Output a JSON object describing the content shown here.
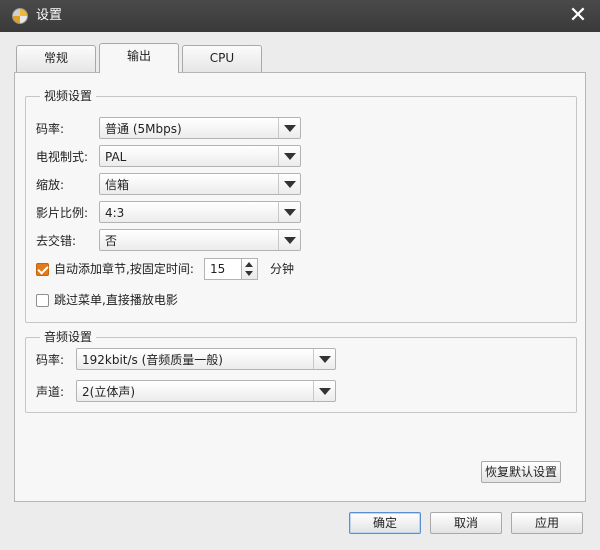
{
  "window": {
    "title": "设置",
    "close_glyph": "✕"
  },
  "tabs": [
    {
      "label": "常规"
    },
    {
      "label": "输出"
    },
    {
      "label": "CPU"
    }
  ],
  "video": {
    "legend": "视频设置",
    "bitrate": {
      "label": "码率:",
      "value": "普通 (5Mbps)"
    },
    "tv_standard": {
      "label": "电视制式:",
      "value": "PAL"
    },
    "zoom": {
      "label": "缩放:",
      "value": "信箱"
    },
    "aspect": {
      "label": "影片比例:",
      "value": "4:3"
    },
    "deinterlace": {
      "label": "去交错:",
      "value": "否"
    },
    "auto_chapter": {
      "label": "自动添加章节,按固定时间:",
      "checked": true,
      "value": "15",
      "unit": "分钟"
    },
    "skip_menu": {
      "label": "跳过菜单,直接播放电影",
      "checked": false
    }
  },
  "audio": {
    "legend": "音频设置",
    "bitrate": {
      "label": "码率:",
      "value": "192kbit/s (音频质量一般)"
    },
    "channel": {
      "label": "声道:",
      "value": "2(立体声)"
    }
  },
  "buttons": {
    "restore_defaults": "恢复默认设置",
    "ok": "确定",
    "cancel": "取消",
    "apply": "应用"
  },
  "colors": {
    "accent": "#e07a1a",
    "titlebar": "#3f3f3f",
    "panel": "#f7f7f7"
  }
}
